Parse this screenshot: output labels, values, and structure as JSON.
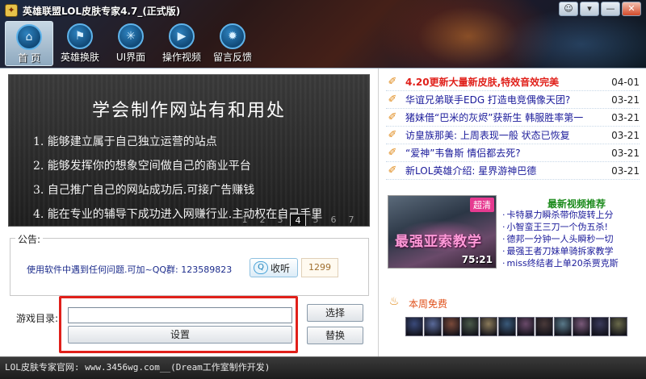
{
  "window": {
    "title": "英雄联盟LOL皮肤专家4.7_(正式版)",
    "logo_glyph": "✦",
    "controls": [
      "☺",
      "▾",
      "—",
      "✕"
    ]
  },
  "nav": [
    {
      "label": "首 页",
      "icon": "home-icon",
      "glyph": "⌂",
      "active": true
    },
    {
      "label": "英雄换肤",
      "icon": "flag-icon",
      "glyph": "⚑",
      "active": false
    },
    {
      "label": "UI界面",
      "icon": "snowflake-icon",
      "glyph": "✳",
      "active": false
    },
    {
      "label": "操作视频",
      "icon": "film-icon",
      "glyph": "▶",
      "active": false
    },
    {
      "label": "留言反馈",
      "icon": "bug-icon",
      "glyph": "✹",
      "active": false
    }
  ],
  "banner": {
    "title": "学会制作网站有和用处",
    "lines": [
      "1. 能够建立属于自己独立运营的站点",
      "2. 能够发挥你的想象空间做自己的商业平台",
      "3. 自己推广自己的网站成功后.可接广告赚钱",
      "4. 能在专业的辅导下成功进入网赚行业.主动权在自己手里"
    ],
    "pages": [
      "1",
      "2",
      "3",
      "4",
      "5",
      "6",
      "7"
    ],
    "active_page": "4"
  },
  "notice": {
    "legend": "公告:",
    "text": "使用软件中遇到任何问题.可加~QQ群: 123589823",
    "follow_label": "收听",
    "follow_count": "1299"
  },
  "game_dir": {
    "label": "游戏目录:",
    "value": "",
    "settings_label": "设置",
    "select_label": "选择",
    "replace_label": "替换"
  },
  "news": [
    {
      "title": "4.20更新大量新皮肤,特效音效完美",
      "date": "04-01",
      "hot": true
    },
    {
      "title": "华谊兄弟联手EDG 打造电竞偶像天团?",
      "date": "03-21",
      "hot": false
    },
    {
      "title": "猪妹借“巴米的灰烬”获新生 韩服胜率第一",
      "date": "03-21",
      "hot": false
    },
    {
      "title": "访皇族那美: 上周表现一般 状态已恢复",
      "date": "03-21",
      "hot": false
    },
    {
      "title": "“爱神”韦鲁斯 情侣都去死?",
      "date": "03-21",
      "hot": false
    },
    {
      "title": "新LOL英雄介绍: 星界游神巴德",
      "date": "03-21",
      "hot": false
    }
  ],
  "video": {
    "overlay_text": "最强亚索教学",
    "hd_badge": "超清",
    "duration": "75:21",
    "section_title": "最新视频推荐",
    "items": [
      "卡特暴力瞬杀带你旋转上分",
      "小智蛮王三刀一个伪五杀!",
      "德邦一分钟一人头瞬秒一切",
      "最强王者刀妹单骑拆家教学",
      "miss终结者上单20杀贾克斯"
    ]
  },
  "free_week": {
    "title": "本周免费",
    "champion_colors": [
      "#3a4a7a",
      "#5a6a9a",
      "#7a4a3a",
      "#4a5a4a",
      "#8a7a5a",
      "#3a5a7a",
      "#6a4a6a",
      "#4a3a3a",
      "#5a7a8a",
      "#7a5a7a",
      "#3a3a5a",
      "#6a6a4a"
    ]
  },
  "status": {
    "text": "LOL皮肤专家官网: www.3456wg.com__(Dream工作室制作开发)"
  }
}
